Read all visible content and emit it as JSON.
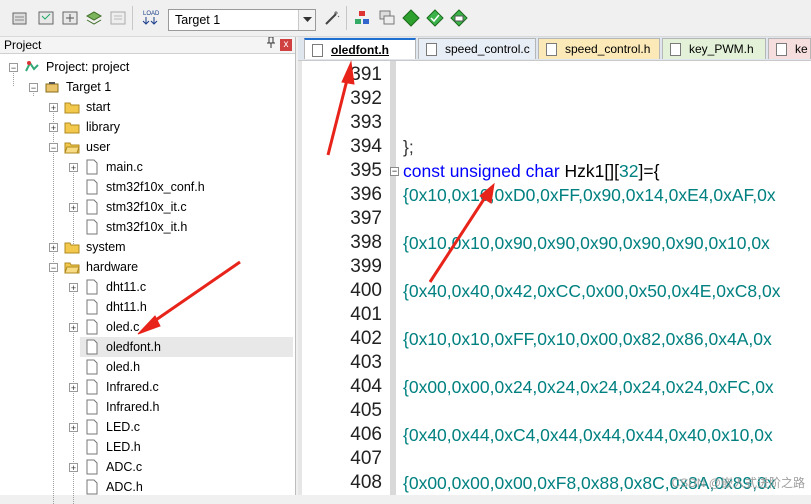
{
  "toolbar": {
    "target_value": "Target 1",
    "buttons": [
      "settings-icon",
      "batch-build-icon",
      "rebuild-icon",
      "stack-icon",
      "load-icon"
    ],
    "right_buttons": [
      "manage-icon",
      "copy-icon",
      "diamond-icon",
      "check-icon",
      "pack-icon"
    ]
  },
  "project_panel": {
    "title": "Project",
    "pin": "$",
    "close": "x",
    "tree": [
      {
        "label": "Project: project"
      },
      {
        "label": "Target 1"
      },
      {
        "label": "start"
      },
      {
        "label": "library"
      },
      {
        "label": "user"
      },
      {
        "label": "main.c"
      },
      {
        "label": "stm32f10x_conf.h"
      },
      {
        "label": "stm32f10x_it.c"
      },
      {
        "label": "stm32f10x_it.h"
      },
      {
        "label": "system"
      },
      {
        "label": "hardware"
      },
      {
        "label": "dht11.c"
      },
      {
        "label": "dht11.h"
      },
      {
        "label": "oled.c"
      },
      {
        "label": "oledfont.h"
      },
      {
        "label": "oled.h"
      },
      {
        "label": "Infrared.c"
      },
      {
        "label": "Infrared.h"
      },
      {
        "label": "LED.c"
      },
      {
        "label": "LED.h"
      },
      {
        "label": "ADC.c"
      },
      {
        "label": "ADC.h"
      }
    ]
  },
  "tabs": [
    {
      "label": "oledfont.h",
      "active": true,
      "color": "#ffffff"
    },
    {
      "label": "speed_control.c",
      "active": false,
      "color": "#e8eef6"
    },
    {
      "label": "speed_control.h",
      "active": false,
      "color": "#fbe9b8"
    },
    {
      "label": "key_PWM.h",
      "active": false,
      "color": "#e3f1d8"
    },
    {
      "label": "ke",
      "active": false,
      "color": "#f7dede"
    }
  ],
  "editor": {
    "line_numbers": [
      "391",
      "392",
      "393",
      "394",
      "395",
      "396",
      "397",
      "398",
      "399",
      "400",
      "401",
      "402",
      "403",
      "404",
      "405",
      "406",
      "407",
      "408"
    ],
    "lines": [
      "",
      "",
      "",
      "};",
      "const unsigned char Hzk1[][32]={",
      "{0x10,0x10,0xD0,0xFF,0x90,0x14,0xE4,0xAF,0x",
      "",
      "{0x10,0x10,0x90,0x90,0x90,0x90,0x90,0x10,0x",
      "",
      "{0x40,0x40,0x42,0xCC,0x00,0x50,0x4E,0xC8,0x",
      "",
      "{0x10,0x10,0xFF,0x10,0x00,0x82,0x86,0x4A,0x",
      "",
      "{0x00,0x00,0x24,0x24,0x24,0x24,0x24,0xFC,0x",
      "",
      "{0x40,0x44,0xC4,0x44,0x44,0x44,0x40,0x10,0x",
      "",
      "{0x00,0x00,0x00,0xF8,0x88,0x8C,0x8A,0x89,0x"
    ],
    "decl": {
      "kw1": "const",
      "kw2": "unsigned",
      "kw3": "char",
      "name": "Hzk1",
      "open": "[][",
      "num": "32",
      "close": "]={"
    }
  },
  "watermark": "CSDN @嵌入式进阶之路",
  "colors": {
    "accent": "#1f6fd0",
    "teal": "#008080",
    "keyword": "#0000ff",
    "arrow": "#e8231a"
  }
}
